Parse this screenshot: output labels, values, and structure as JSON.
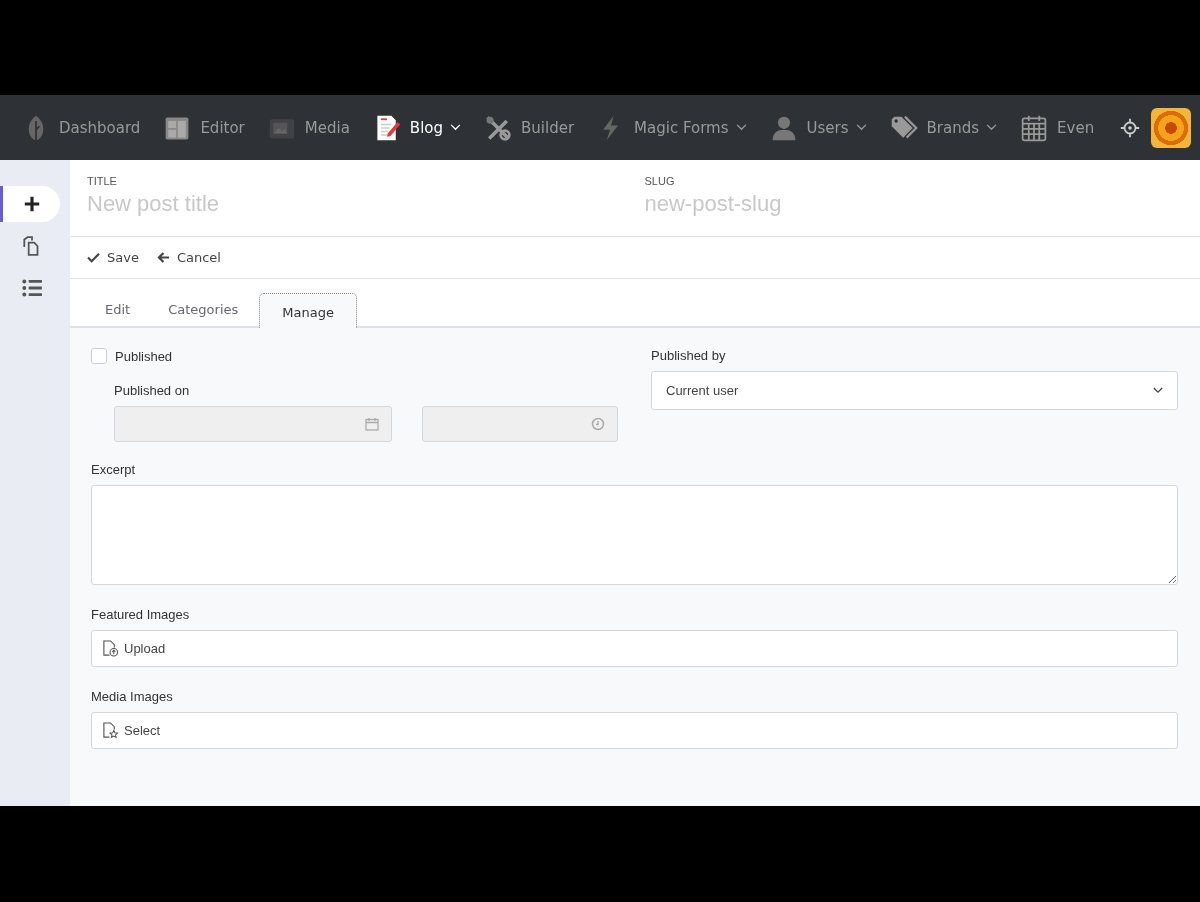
{
  "navbar": {
    "items": [
      {
        "label": "Dashboard",
        "selected": false,
        "dropdown": false
      },
      {
        "label": "Editor",
        "selected": false,
        "dropdown": false
      },
      {
        "label": "Media",
        "selected": false,
        "dropdown": false
      },
      {
        "label": "Blog",
        "selected": true,
        "dropdown": true
      },
      {
        "label": "Builder",
        "selected": false,
        "dropdown": false
      },
      {
        "label": "Magic Forms",
        "selected": false,
        "dropdown": true
      },
      {
        "label": "Users",
        "selected": false,
        "dropdown": true
      },
      {
        "label": "Brands",
        "selected": false,
        "dropdown": true
      },
      {
        "label": "Even",
        "selected": false,
        "dropdown": false
      }
    ]
  },
  "sidebar": {
    "items": [
      {
        "selected": true
      },
      {
        "selected": false
      },
      {
        "selected": false
      }
    ]
  },
  "header": {
    "title_label": "TITLE",
    "title_placeholder": "New post title",
    "slug_label": "SLUG",
    "slug_placeholder": "new-post-slug"
  },
  "toolbar": {
    "save": "Save",
    "cancel": "Cancel"
  },
  "tabs": [
    {
      "label": "Edit",
      "selected": false
    },
    {
      "label": "Categories",
      "selected": false
    },
    {
      "label": "Manage",
      "selected": true
    }
  ],
  "form": {
    "published": {
      "label": "Published",
      "checked": false
    },
    "published_on": {
      "label": "Published on",
      "disabled": true
    },
    "published_by": {
      "label": "Published by",
      "value": "Current user"
    },
    "excerpt": {
      "label": "Excerpt"
    },
    "featured_images": {
      "label": "Featured Images",
      "button": "Upload"
    },
    "media_images": {
      "label": "Media Images",
      "button": "Select"
    }
  }
}
